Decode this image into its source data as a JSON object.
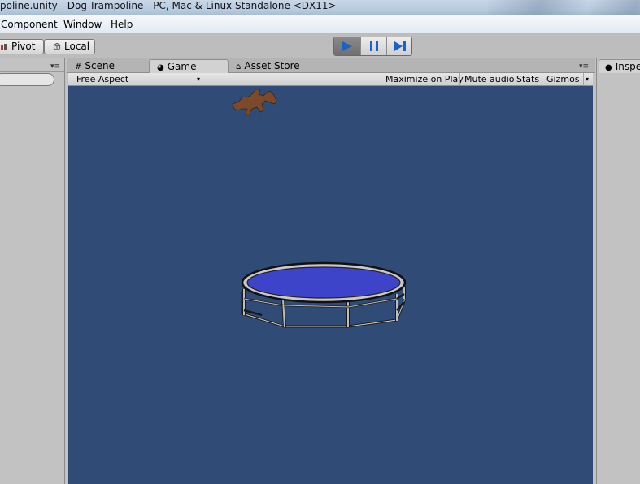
{
  "window": {
    "title": "poline.unity - Dog-Trampoline - PC, Mac & Linux Standalone <DX11>"
  },
  "menu": {
    "items": [
      "Component",
      "Window",
      "Help"
    ]
  },
  "toolbar": {
    "pivot_label": "Pivot",
    "local_label": "Local",
    "play_active": true
  },
  "tabs": {
    "scene_label": "Scene",
    "game_label": "Game",
    "asset_store_label": "Asset Store",
    "inspector_label": "Inspe"
  },
  "game_bar": {
    "aspect_label": "Free Aspect",
    "maximize_label": "Maximize on Play",
    "mute_label": "Mute audio",
    "stats_label": "Stats",
    "gizmos_label": "Gizmos"
  },
  "colors": {
    "game_background": "#2f4b76",
    "trampoline_mat": "#3e44c9",
    "dog": "#7a4a2a",
    "play_icon": "#1e5fc8"
  },
  "icons": [
    "pivot-icon",
    "local-cube-icon",
    "play-icon",
    "pause-icon",
    "step-icon",
    "scene-grid-icon",
    "game-icon",
    "asset-store-icon",
    "inspector-icon",
    "panel-menu-icon",
    "dropdown-arrow-icon"
  ]
}
